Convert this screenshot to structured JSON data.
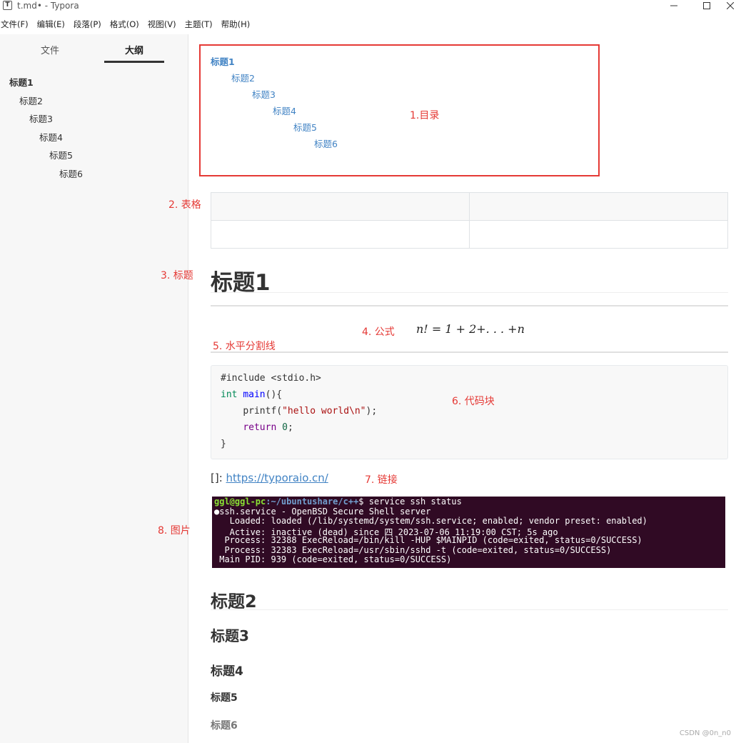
{
  "window": {
    "logo": "T",
    "title": "t.md• - Typora"
  },
  "menu": [
    "文件(F)",
    "编辑(E)",
    "段落(P)",
    "格式(O)",
    "视图(V)",
    "主题(T)",
    "帮助(H)"
  ],
  "sidebar": {
    "tabs": [
      {
        "label": "文件"
      },
      {
        "label": "大纲"
      }
    ],
    "outline": [
      "标题1",
      "标题2",
      "标题3",
      "标题4",
      "标题5",
      "标题6"
    ]
  },
  "toc": [
    "标题1",
    "标题2",
    "标题3",
    "标题4",
    "标题5",
    "标题6"
  ],
  "annotations": {
    "toc": "1.目录",
    "table": "2. 表格",
    "heading": "3. 标题",
    "formula": "4. 公式",
    "hr": "5. 水平分割线",
    "code": "6. 代码块",
    "link": "7. 链接",
    "image": "8. 图片"
  },
  "content": {
    "h1": "标题1",
    "formula": "n! = 1 + 2+. . . +n",
    "link_prefix": "[]: ",
    "link_url": "https://typoraio.cn/",
    "h2": "标题2",
    "h3": "标题3",
    "h4": "标题4",
    "h5": "标题5",
    "h6": "标题6"
  },
  "code": {
    "include": "#include <stdio.h>",
    "int_kw": "int",
    "main_fn": "main",
    "main_rest": "(){",
    "printf": "printf(",
    "str": "\"hello world\\n\"",
    "printf_end": ");",
    "return_kw": "return",
    "zero": "0",
    "semicolon": ";",
    "close": "}"
  },
  "terminal": {
    "user": "ggl@ggl-pc",
    "path": ":~/ubuntushare/c++",
    "cmd": "$ service ssh status",
    "lines": [
      "●ssh.service - OpenBSD Secure Shell server",
      "   Loaded: loaded (/lib/systemd/system/ssh.service; enabled; vendor preset: enabled)",
      "   Active: inactive (dead) since 四 2023-07-06 11:19:00 CST; 5s ago",
      "  Process: 32388 ExecReload=/bin/kill -HUP $MAINPID (code=exited, status=0/SUCCESS)",
      "  Process: 32383 ExecReload=/usr/sbin/sshd -t (code=exited, status=0/SUCCESS)",
      " Main PID: 939 (code=exited, status=0/SUCCESS)"
    ]
  },
  "watermark": "CSDN @0n_n0"
}
